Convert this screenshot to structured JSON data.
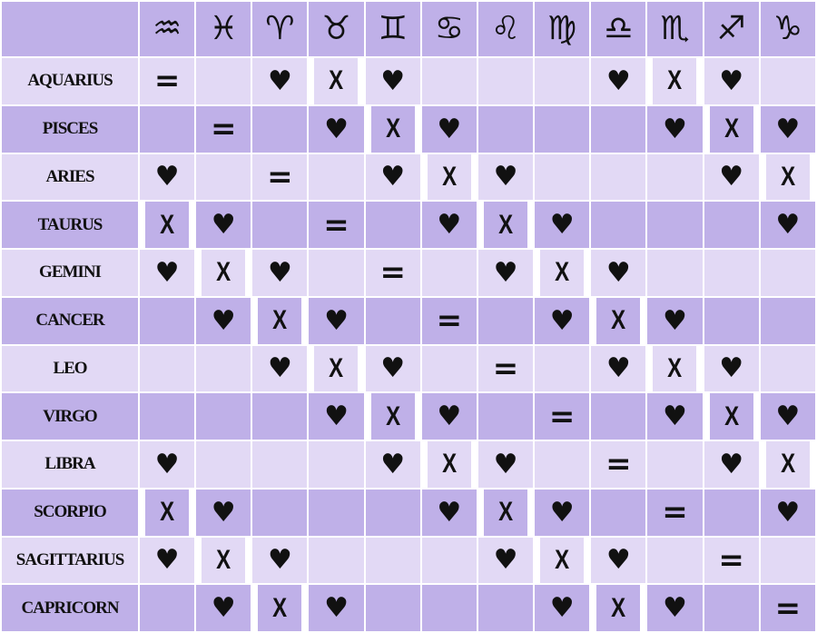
{
  "colors": {
    "header": "#bfb0e8",
    "row_dark": "#bfb0e8",
    "row_light": "#e2d9f5",
    "border": "#ffffff"
  },
  "legend_symbols": {
    "=": "same sign",
    "♥": "heart",
    "X": "x-mark"
  },
  "columns": [
    {
      "sign": "Aquarius",
      "glyph": "♒︎"
    },
    {
      "sign": "Pisces",
      "glyph": "♓︎"
    },
    {
      "sign": "Aries",
      "glyph": "♈︎"
    },
    {
      "sign": "Taurus",
      "glyph": "♉︎"
    },
    {
      "sign": "Gemini",
      "glyph": "♊︎"
    },
    {
      "sign": "Cancer",
      "glyph": "♋︎"
    },
    {
      "sign": "Leo",
      "glyph": "♌︎"
    },
    {
      "sign": "Virgo",
      "glyph": "♍︎"
    },
    {
      "sign": "Libra",
      "glyph": "♎︎"
    },
    {
      "sign": "Scorpio",
      "glyph": "♏︎"
    },
    {
      "sign": "Sagittarius",
      "glyph": "♐︎"
    },
    {
      "sign": "Capricorn",
      "glyph": "♑︎"
    }
  ],
  "rows": [
    {
      "label": "Aquarius",
      "cells": [
        "=",
        "",
        "♥",
        "X",
        "♥",
        "",
        "",
        "",
        "♥",
        "X",
        "♥",
        ""
      ]
    },
    {
      "label": "Pisces",
      "cells": [
        "",
        "=",
        "",
        "♥",
        "X",
        "♥",
        "",
        "",
        "",
        "♥",
        "X",
        "♥"
      ]
    },
    {
      "label": "Aries",
      "cells": [
        "♥",
        "",
        "=",
        "",
        "♥",
        "X",
        "♥",
        "",
        "",
        "",
        "♥",
        "X"
      ]
    },
    {
      "label": "Taurus",
      "cells": [
        "X",
        "♥",
        "",
        "=",
        "",
        "♥",
        "X",
        "♥",
        "",
        "",
        "",
        "♥"
      ]
    },
    {
      "label": "Gemini",
      "cells": [
        "♥",
        "X",
        "♥",
        "",
        "=",
        "",
        "♥",
        "X",
        "♥",
        "",
        "",
        ""
      ]
    },
    {
      "label": "Cancer",
      "cells": [
        "",
        "♥",
        "X",
        "♥",
        "",
        "=",
        "",
        "♥",
        "X",
        "♥",
        "",
        ""
      ]
    },
    {
      "label": "Leo",
      "cells": [
        "",
        "",
        "♥",
        "X",
        "♥",
        "",
        "=",
        "",
        "♥",
        "X",
        "♥",
        ""
      ]
    },
    {
      "label": "Virgo",
      "cells": [
        "",
        "",
        "",
        "♥",
        "X",
        "♥",
        "",
        "=",
        "",
        "♥",
        "X",
        "♥"
      ]
    },
    {
      "label": "Libra",
      "cells": [
        "♥",
        "",
        "",
        "",
        "♥",
        "X",
        "♥",
        "",
        "=",
        "",
        "♥",
        "X"
      ]
    },
    {
      "label": "Scorpio",
      "cells": [
        "X",
        "♥",
        "",
        "",
        "",
        "♥",
        "X",
        "♥",
        "",
        "=",
        "",
        "♥"
      ]
    },
    {
      "label": "Sagittarius",
      "cells": [
        "♥",
        "X",
        "♥",
        "",
        "",
        "",
        "♥",
        "X",
        "♥",
        "",
        "=",
        ""
      ]
    },
    {
      "label": "Capricorn",
      "cells": [
        "",
        "♥",
        "X",
        "♥",
        "",
        "",
        "",
        "♥",
        "X",
        "♥",
        "",
        "="
      ]
    }
  ]
}
